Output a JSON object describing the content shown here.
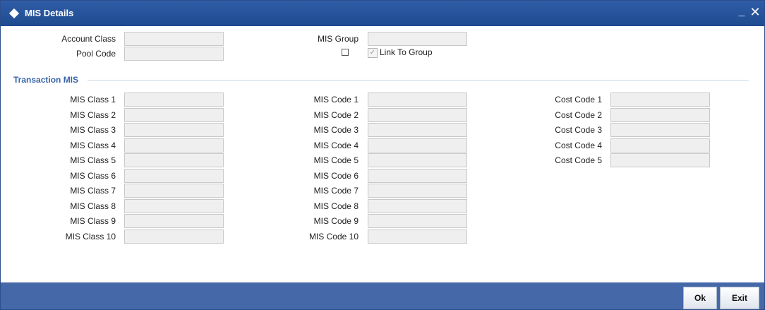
{
  "window": {
    "title": "MIS Details",
    "minimize_glyph": "_",
    "close_glyph": "✕"
  },
  "header": {
    "account_class": {
      "label": "Account Class",
      "value": ""
    },
    "pool_code": {
      "label": "Pool Code",
      "value": ""
    },
    "mis_group": {
      "label": "MIS Group",
      "value": ""
    },
    "link_to_group": {
      "label": "Link To Group",
      "checked": true,
      "check_glyph": "✓"
    }
  },
  "transaction_mis": {
    "title": "Transaction MIS",
    "mis_classes": [
      {
        "label": "MIS Class 1",
        "value": ""
      },
      {
        "label": "MIS Class 2",
        "value": ""
      },
      {
        "label": "MIS Class 3",
        "value": ""
      },
      {
        "label": "MIS Class 4",
        "value": ""
      },
      {
        "label": "MIS Class 5",
        "value": ""
      },
      {
        "label": "MIS Class 6",
        "value": ""
      },
      {
        "label": "MIS Class 7",
        "value": ""
      },
      {
        "label": "MIS Class 8",
        "value": ""
      },
      {
        "label": "MIS Class 9",
        "value": ""
      },
      {
        "label": "MIS Class 10",
        "value": ""
      }
    ],
    "mis_codes": [
      {
        "label": "MIS Code 1",
        "value": ""
      },
      {
        "label": "MIS Code 2",
        "value": ""
      },
      {
        "label": "MIS Code 3",
        "value": ""
      },
      {
        "label": "MIS Code 4",
        "value": ""
      },
      {
        "label": "MIS Code 5",
        "value": ""
      },
      {
        "label": "MIS Code 6",
        "value": ""
      },
      {
        "label": "MIS Code 7",
        "value": ""
      },
      {
        "label": "MIS Code 8",
        "value": ""
      },
      {
        "label": "MIS Code 9",
        "value": ""
      },
      {
        "label": "MIS Code 10",
        "value": ""
      }
    ],
    "cost_codes": [
      {
        "label": "Cost Code 1",
        "value": ""
      },
      {
        "label": "Cost Code 2",
        "value": ""
      },
      {
        "label": "Cost Code 3",
        "value": ""
      },
      {
        "label": "Cost Code 4",
        "value": ""
      },
      {
        "label": "Cost Code 5",
        "value": ""
      }
    ]
  },
  "footer": {
    "ok_label": "Ok",
    "exit_label": "Exit"
  },
  "colors": {
    "titlebar": "#2f5da6",
    "footer": "#4468a8",
    "section_title": "#3a66a8"
  }
}
